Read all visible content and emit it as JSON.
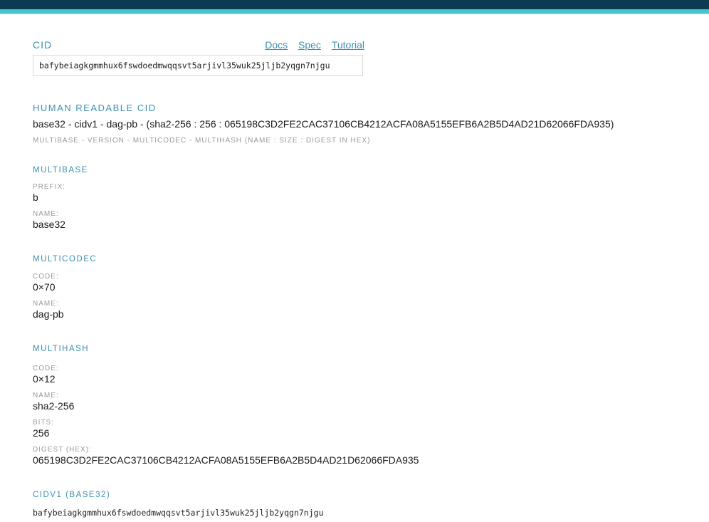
{
  "header": {
    "top_color": "#0b3a53",
    "accent_color": "#47c3cf"
  },
  "cid_input": {
    "label": "CID",
    "value": "bafybeiagkgmmhux6fswdoedmwqqsvt5arjivl35wuk25jljb2yqgn7njgu",
    "links": [
      "Docs",
      "Spec",
      "Tutorial"
    ]
  },
  "human_readable": {
    "title": "HUMAN READABLE CID",
    "value": "base32 - cidv1 - dag-pb - (sha2-256 : 256 : 065198C3D2FE2CAC37106CB4212ACFA08A5155EFB6A2B5D4AD21D62066FDA935)",
    "legend": "MULTIBASE - VERSION - MULTICODEC - MULTIHASH (NAME : SIZE : DIGEST IN HEX)"
  },
  "multibase": {
    "title": "MULTIBASE",
    "prefix_label": "PREFIX:",
    "prefix": "b",
    "name_label": "NAME:",
    "name": "base32"
  },
  "multicodec": {
    "title": "MULTICODEC",
    "code_label": "CODE:",
    "code": "0×70",
    "name_label": "NAME:",
    "name": "dag-pb"
  },
  "multihash": {
    "title": "MULTIHASH",
    "code_label": "CODE:",
    "code": "0×12",
    "name_label": "NAME:",
    "name": "sha2-256",
    "bits_label": "BITS:",
    "bits": "256",
    "digest_label": "DIGEST (HEX):",
    "digest": "065198C3D2FE2CAC37106CB4212ACFA08A5155EFB6A2B5D4AD21D62066FDA935"
  },
  "cidv1": {
    "title": "CIDV1 (BASE32)",
    "value": "bafybeiagkgmmhux6fswdoedmwqqsvt5arjivl35wuk25jljb2yqgn7njgu"
  }
}
